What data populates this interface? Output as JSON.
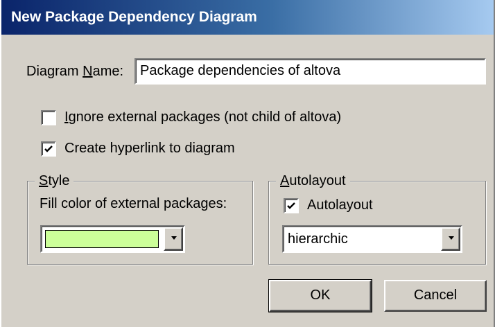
{
  "window": {
    "title": "New Package Dependency Diagram"
  },
  "diagram_name": {
    "label_before": "Diagram ",
    "label_mnemonic": "N",
    "label_after": "ame:",
    "value": "Package dependencies of altova"
  },
  "options": {
    "ignore_external": {
      "mnemonic": "I",
      "label_rest": "gnore external packages (not child of altova)",
      "checked": false
    },
    "create_hyperlink": {
      "label": "Create hyperlink to diagram",
      "checked": true
    }
  },
  "style_group": {
    "title_mnemonic": "S",
    "title_rest": "tyle",
    "fill_label": "Fill color of external packages:",
    "fill_color": "#ccff99"
  },
  "autolayout_group": {
    "title_mnemonic": "A",
    "title_rest": "utolayout",
    "checkbox_label": "Autolayout",
    "checked": true,
    "selected_layout": "hierarchic"
  },
  "buttons": {
    "ok": "OK",
    "cancel": "Cancel"
  }
}
